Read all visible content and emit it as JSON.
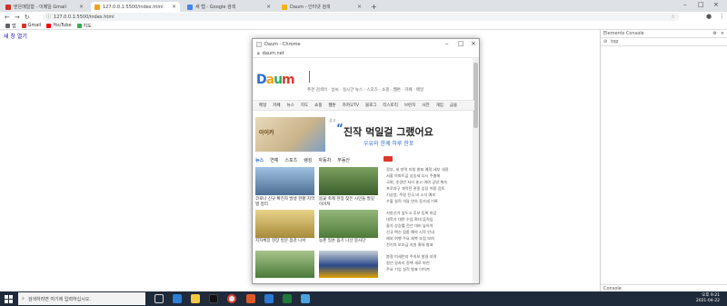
{
  "browser": {
    "tabs": [
      {
        "title": "받은메일함 - 이메일 Gmail",
        "color": "#d93025"
      },
      {
        "title": "127.0.0.1:5500/index.html",
        "color": "#f0a020"
      },
      {
        "title": "새 탭 - Google 검색",
        "color": "#4285f4"
      },
      {
        "title": "Daum - 인터넷 검색",
        "color": "#f4b400"
      }
    ],
    "new_tab_label": "+",
    "address": "127.0.0.1:5500/index.html",
    "bookmarks": [
      {
        "label": "앱",
        "color": "#5f6368"
      },
      {
        "label": "Gmail",
        "color": "#d93025"
      },
      {
        "label": "YouTube",
        "color": "#ff0000"
      },
      {
        "label": "지도",
        "color": "#34a853"
      }
    ]
  },
  "page": {
    "link_text": "새 창 열기"
  },
  "devtools": {
    "tabs": "Elements Console",
    "filter": "top",
    "bottom": "Console"
  },
  "popup": {
    "title": "Daum - Chrome",
    "url": "daum.net",
    "logo": "Daum",
    "keywords": "추천 검색어 · 날씨 · 실시간 뉴스 · 스포츠 · 쇼핑 · 웹툰 · 카페 · 메일",
    "nav": [
      "메일",
      "카페",
      "뉴스",
      "지도",
      "쇼핑",
      "웹툰",
      "카카오TV",
      "블로그",
      "티스토리",
      "브런치",
      "사전",
      "게임",
      "금융"
    ],
    "banner_label": "아이커",
    "ad_tag": "광고",
    "ad_quote": "“",
    "ad_headline": "진작 먹일걸 그랬어요",
    "ad_sub": "우유와 한께 하루 한포",
    "news_tabs": [
      {
        "label": "뉴스",
        "on": true
      },
      {
        "label": "연예",
        "on": false
      },
      {
        "label": "스포츠",
        "on": false
      },
      {
        "label": "랭킹",
        "on": false
      },
      {
        "label": "자동차",
        "on": false
      },
      {
        "label": "부동산",
        "on": false
      }
    ],
    "cards": [
      {
        "caption": "코로나 신규 확진자 발생 현황 지역별 정리",
        "color": "#6a8db0"
      },
      {
        "caption": "봄꽃 축제 현장 찾은 시민들 발길 이어져",
        "color": "#4f7a3a"
      },
      {
        "caption": "지자체장 현장 방문 점검 나서",
        "color": "#c7a24a"
      },
      {
        "caption": "농촌 일손 돕기 나선 봉사단",
        "color": "#5c8a4a"
      },
      {
        "caption": "",
        "color": "#4a7a3a"
      },
      {
        "caption": "",
        "color": "#2a4a8a"
      }
    ],
    "news_lines": [
      "정부, 새 방역 지침 발표 예정 세부 내용",
      "서울 아파트값 상승세 다시 주춤해",
      "국회, 추경안 처리 놓고 여야 공방 계속",
      "프로야구 개막전 관중 입장 허용 검토",
      "기상청, 주말 전국 비 소식 예보",
      "수출 실적 석달 연속 증가세 기록",
      "",
      "지방선거 앞두고 후보 등록 마감",
      "대학가 대면 수업 확대 움직임",
      "물가 상승률 전년 대비 높아져",
      "신규 백신 접종 예약 시작 안내",
      "해외 여행 수요 회복 조짐 보여",
      "전기차 보조금 지원 확대 발표",
      "",
      "봄철 미세먼지 주의보 발령 지역",
      "청년 일자리 정책 새로 마련",
      "주요 기업 실적 발표 이어져"
    ]
  },
  "taskbar": {
    "search_placeholder": "검색하려면 여기에 입력하십시오.",
    "time": "오후 9:21",
    "date": "2021-04-22"
  }
}
